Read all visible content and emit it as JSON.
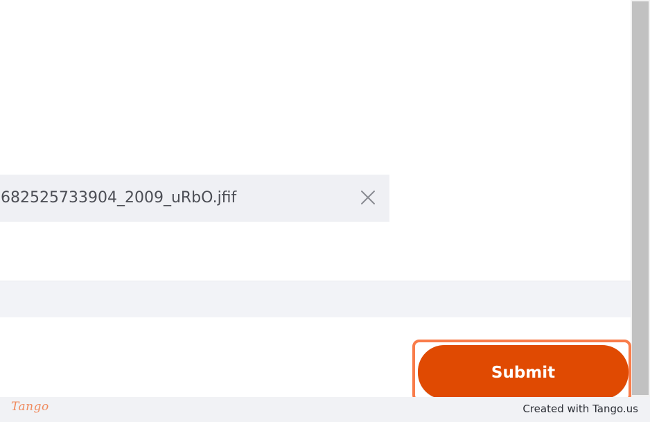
{
  "attachment": {
    "file_name": "682525733904_2009_uRbO.jfif",
    "remove_icon": "close-icon"
  },
  "actions": {
    "submit_label": "Submit"
  },
  "footer": {
    "brand": "Tango",
    "created_with": "Created with Tango.us"
  },
  "colors": {
    "submit_background": "#e04a02",
    "highlight_border": "#f97c4a",
    "file_chip_background": "#eff0f4",
    "brand_color": "#f08a5d"
  }
}
